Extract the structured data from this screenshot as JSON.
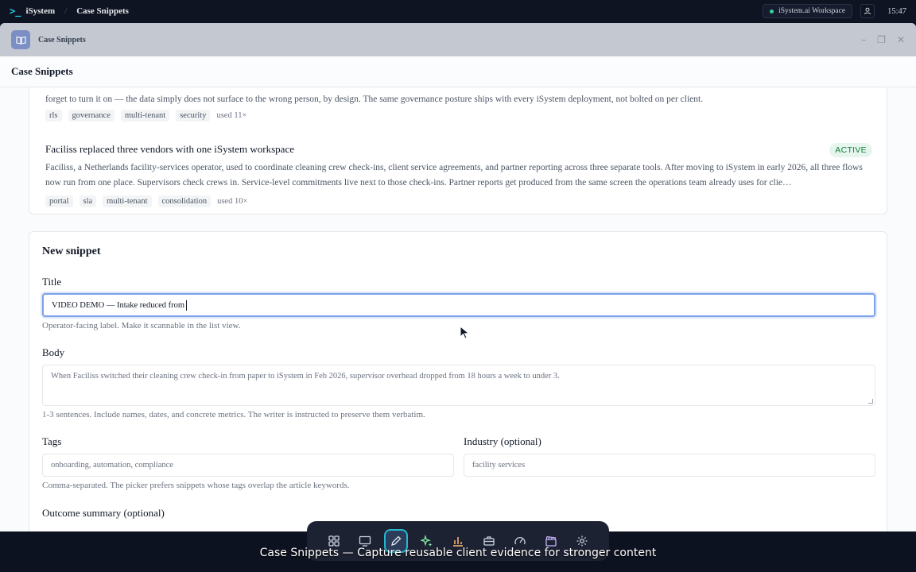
{
  "topbar": {
    "logo_glyph": ">_",
    "brand": "iSystem",
    "separator": "/",
    "context_title": "Case Snippets",
    "workspace": "iSystem.ai Workspace",
    "time": "15:47"
  },
  "window": {
    "title": "Case Snippets",
    "header_title": "Case Snippets",
    "controls": [
      "–",
      "❐",
      "✕"
    ]
  },
  "snippets": [
    {
      "body_tail": "forget to turn it on — the data simply does not surface to the wrong person, by design. The same governance posture ships with every iSystem deployment, not bolted on per client.",
      "tags": [
        "rls",
        "governance",
        "multi-tenant",
        "security"
      ],
      "used": "used 11×"
    },
    {
      "title": "Faciliss replaced three vendors with one iSystem workspace",
      "status": "ACTIVE",
      "body": "Faciliss, a Netherlands facility-services operator, used to coordinate cleaning crew check-ins, client service agreements, and partner reporting across three separate tools. After moving to iSystem in early 2026, all three flows now run from one place. Supervisors check crews in. Service-level commitments live next to those check-ins. Partner reports get produced from the same screen the operations team already uses for clie…",
      "tags": [
        "portal",
        "sla",
        "multi-tenant",
        "consolidation"
      ],
      "used": "used 10×"
    }
  ],
  "form": {
    "heading": "New snippet",
    "title_label": "Title",
    "title_value": "VIDEO DEMO — Intake reduced from",
    "title_help": "Operator-facing label. Make it scannable in the list view.",
    "body_label": "Body",
    "body_value": "When Faciliss switched their cleaning crew check-in from paper to iSystem in Feb 2026, supervisor overhead dropped from 18 hours a week to under 3.",
    "body_help": "1-3 sentences. Include names, dates, and concrete metrics. The writer is instructed to preserve them verbatim.",
    "tags_label": "Tags",
    "tags_placeholder": "onboarding, automation, compliance",
    "tags_help": "Comma-separated. The picker prefers snippets whose tags overlap the article keywords.",
    "industry_label": "Industry (optional)",
    "industry_placeholder": "facility services",
    "outcome_label": "Outcome summary (optional)"
  },
  "dock": {
    "items": [
      "grid-icon",
      "monitor-icon",
      "pen-icon",
      "sparkle-icon",
      "bar-chart-icon",
      "briefcase-icon",
      "gauge-icon",
      "clapperboard-icon",
      "settings-icon"
    ],
    "active": "pen-icon"
  },
  "caption": "Case Snippets — Capture reusable client evidence for stronger content"
}
